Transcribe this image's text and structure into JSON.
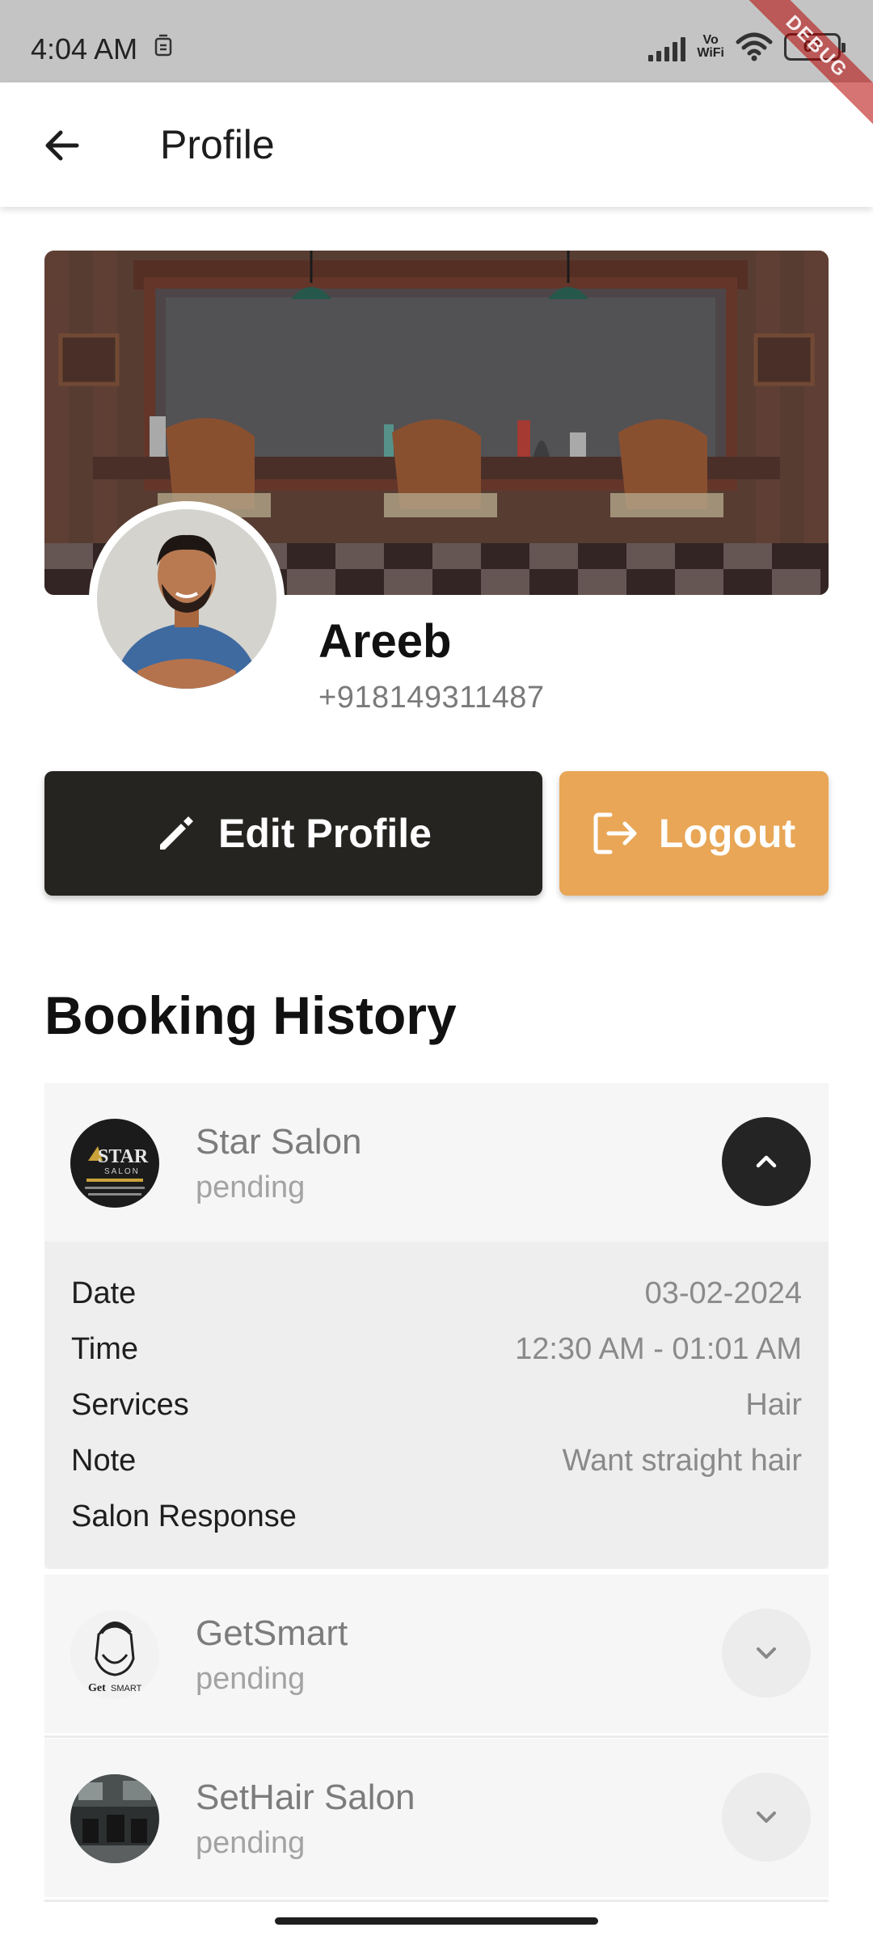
{
  "status_bar": {
    "time": "4:04 AM",
    "vowifi_top": "Vo",
    "vowifi_bottom": "WiFi",
    "battery": "67",
    "debug_label": "DEBUG"
  },
  "app_bar": {
    "title": "Profile",
    "back_icon": "arrow-left-icon"
  },
  "profile": {
    "name": "Areeb",
    "phone": "+918149311487"
  },
  "actions": {
    "edit_label": "Edit Profile",
    "edit_icon": "pencil-icon",
    "logout_label": "Logout",
    "logout_icon": "logout-icon"
  },
  "booking_history": {
    "title": "Booking History",
    "bookings": [
      {
        "salon": "Star Salon",
        "status": "pending",
        "expanded": true,
        "details": {
          "date_label": "Date",
          "date": "03-02-2024",
          "time_label": "Time",
          "time": "12:30 AM - 01:01 AM",
          "services_label": "Services",
          "services": "Hair",
          "note_label": "Note",
          "note": "Want straight hair",
          "response_label": "Salon Response",
          "response": ""
        }
      },
      {
        "salon": "GetSmart",
        "status": "pending",
        "expanded": false
      },
      {
        "salon": "SetHair Salon",
        "status": "pending",
        "expanded": false
      }
    ]
  },
  "colors": {
    "edit_button": "#262421",
    "logout_button": "#e8a656",
    "status_bar": "#c4c4c4"
  }
}
